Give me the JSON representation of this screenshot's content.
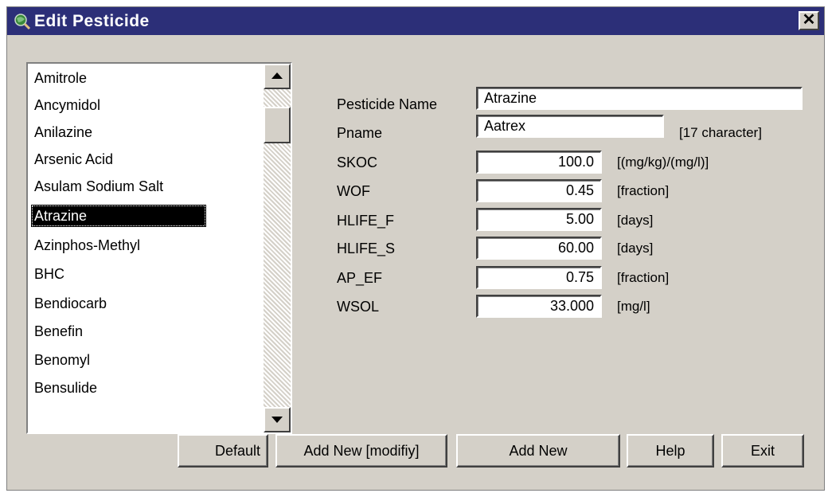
{
  "window": {
    "title": "Edit  Pesticide",
    "close_glyph": "✕",
    "icon": "magnifier-globe-icon"
  },
  "pesticide_list": {
    "items": [
      "Amitrole",
      "Ancymidol",
      "Anilazine",
      "Arsenic Acid",
      "Asulam Sodium Salt",
      "Atrazine",
      "Azinphos-Methyl",
      "BHC",
      "Bendiocarb",
      "Benefin",
      "Benomyl",
      "Bensulide"
    ],
    "selected": "Atrazine"
  },
  "form": {
    "pesticide_name": {
      "label": "Pesticide Name",
      "value": "Atrazine"
    },
    "pname": {
      "label": "Pname",
      "value": "Aatrex",
      "note": "[17 character]"
    },
    "skoc": {
      "label": "SKOC",
      "value": "100.0",
      "unit": "[(mg/kg)/(mg/l)]"
    },
    "wof": {
      "label": "WOF",
      "value": "0.45",
      "unit": "[fraction]"
    },
    "hlife_f": {
      "label": "HLIFE_F",
      "value": "5.00",
      "unit": "[days]"
    },
    "hlife_s": {
      "label": "HLIFE_S",
      "value": "60.00",
      "unit": "[days]"
    },
    "ap_ef": {
      "label": "AP_EF",
      "value": "0.75",
      "unit": "[fraction]"
    },
    "wsol": {
      "label": "WSOL",
      "value": "33.000",
      "unit": "[mg/l]"
    }
  },
  "buttons": {
    "default": "Default",
    "add_new_modify": "Add New [modifiy]",
    "add_new": "Add New",
    "help": "Help",
    "exit": "Exit"
  }
}
